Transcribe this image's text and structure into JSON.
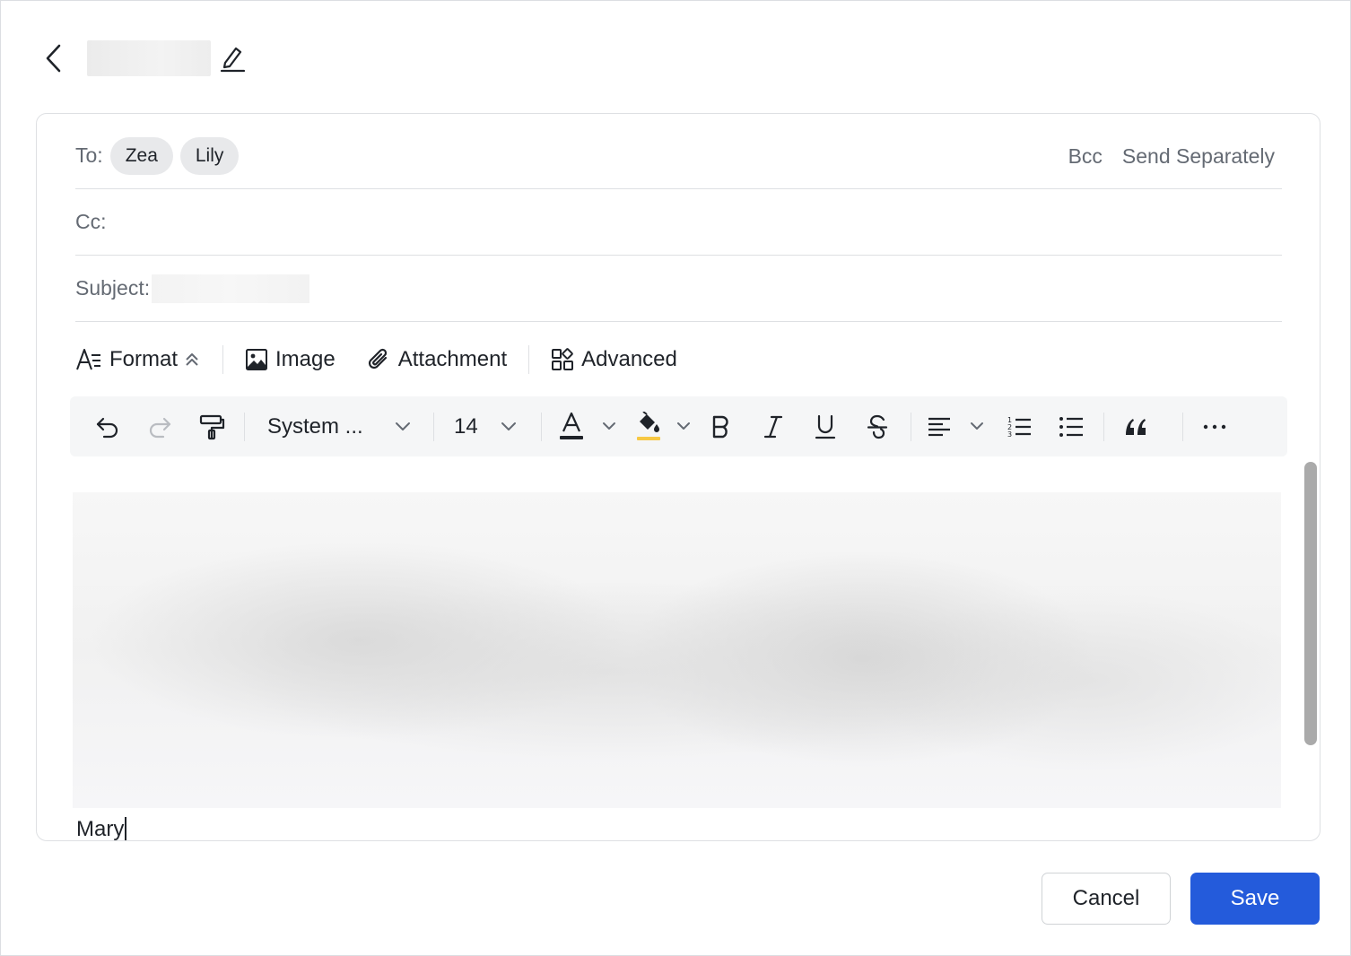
{
  "header": {
    "back_icon": "chevron-left-icon",
    "edit_icon": "pencil-icon"
  },
  "recipients": {
    "to_label": "To:",
    "to_chips": [
      "Zea",
      "Lily"
    ],
    "bcc_label": "Bcc",
    "send_separately_label": "Send Separately",
    "cc_label": "Cc:",
    "subject_label": "Subject:"
  },
  "tabs": {
    "format": "Format",
    "image": "Image",
    "attachment": "Attachment",
    "advanced": "Advanced"
  },
  "toolbar": {
    "font_family": "System ...",
    "font_size": "14",
    "text_color": "#1f2329",
    "highlight_color": "#f7c844"
  },
  "body": {
    "signature": "Mary"
  },
  "footer": {
    "cancel_label": "Cancel",
    "save_label": "Save"
  },
  "colors": {
    "primary": "#245bdb",
    "border": "#dee0e3",
    "muted_text": "#646a73"
  }
}
